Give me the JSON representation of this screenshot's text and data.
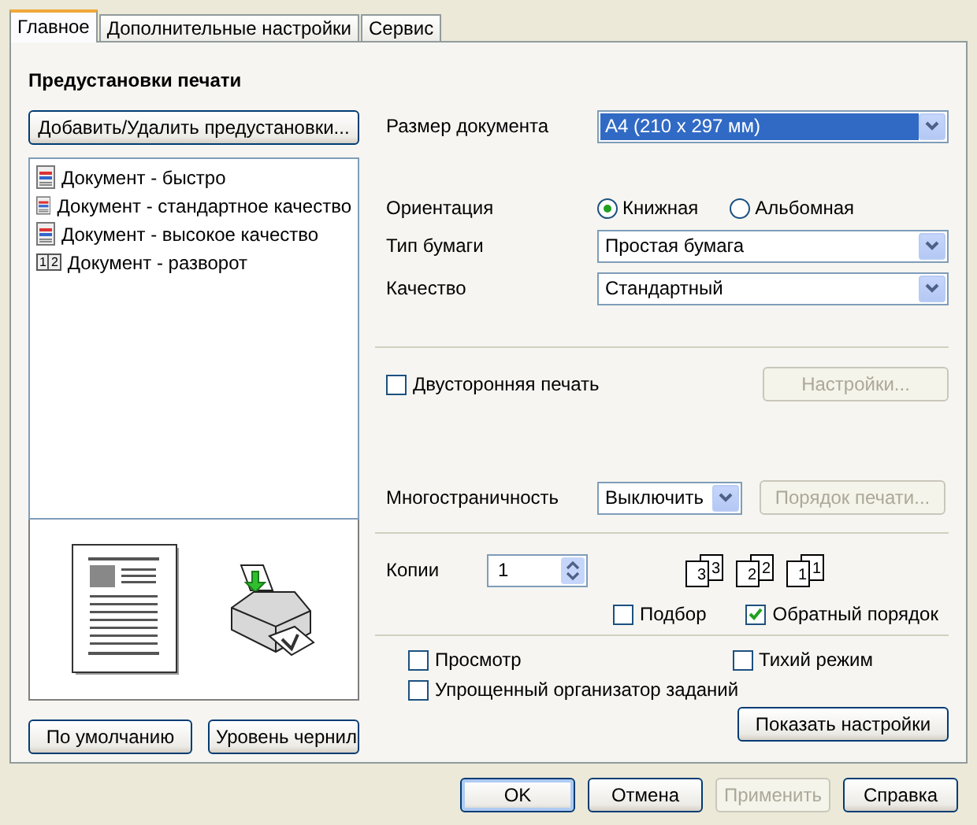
{
  "tabs": [
    {
      "label": "Главное",
      "selected": true
    },
    {
      "label": "Дополнительные настройки",
      "selected": false
    },
    {
      "label": "Сервис",
      "selected": false
    }
  ],
  "presets": {
    "title": "Предустановки печати",
    "add_button": "Добавить/Удалить предустановки...",
    "items": [
      {
        "label": "Документ - быстро",
        "kind": "document"
      },
      {
        "label": "Документ - стандартное качество",
        "kind": "document"
      },
      {
        "label": "Документ - высокое качество",
        "kind": "document"
      },
      {
        "label": "Документ - разворот",
        "kind": "spread",
        "badges": [
          "1",
          "2"
        ]
      }
    ]
  },
  "left_buttons": [
    "По умолчанию",
    "Уровень чернил"
  ],
  "paper_size": {
    "label": "Размер документа",
    "value": "A4 (210 x 297 мм)",
    "focused": true
  },
  "orientation": {
    "label": "Ориентация",
    "options": [
      {
        "label": "Книжная",
        "selected": true
      },
      {
        "label": "Альбомная",
        "selected": false
      }
    ]
  },
  "paper_type": {
    "label": "Тип бумаги",
    "value": "Простая бумага",
    "focused": false
  },
  "quality": {
    "label": "Качество",
    "value": "Стандартный",
    "focused": false
  },
  "duplex": {
    "label": "Двусторонняя печать",
    "checked": false,
    "button": {
      "label": "Настройки...",
      "disabled": true
    }
  },
  "multipage": {
    "label": "Многостраничность",
    "value": "Выключить",
    "button": {
      "label": "Порядок печати...",
      "disabled": true
    }
  },
  "copies": {
    "label": "Копии",
    "value": "1",
    "stacks": [
      {
        "back": "3",
        "front": "3"
      },
      {
        "back": "2",
        "front": "2"
      },
      {
        "back": "1",
        "front": "1"
      }
    ],
    "checks": [
      {
        "label": "Подбор",
        "checked": false
      },
      {
        "label": "Обратный порядок",
        "checked": true
      }
    ]
  },
  "options": [
    {
      "label": "Просмотр",
      "checked": false
    },
    {
      "label": "Тихий режим",
      "checked": false
    },
    {
      "label": "Упрощенный организатор заданий",
      "checked": false
    }
  ],
  "show_settings_button": "Показать настройки",
  "footer_buttons": [
    {
      "label": "OK",
      "disabled": false,
      "default": true
    },
    {
      "label": "Отмена",
      "disabled": false,
      "default": false
    },
    {
      "label": "Применить",
      "disabled": true,
      "default": false
    },
    {
      "label": "Справка",
      "disabled": false,
      "default": false
    }
  ]
}
